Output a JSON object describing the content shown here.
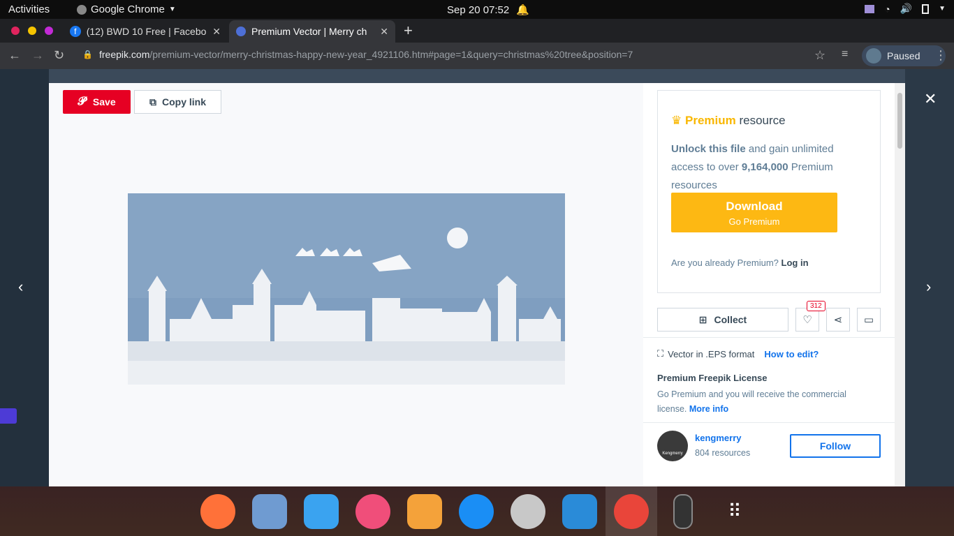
{
  "topbar": {
    "activities": "Activities",
    "app": "Google Chrome",
    "clock": "Sep 20  07:52"
  },
  "tabs": [
    {
      "title": "(12) BWD 10 Free | Facebo"
    },
    {
      "title": "Premium Vector | Merry ch"
    }
  ],
  "address": {
    "domain": "freepik.com",
    "path": "/premium-vector/merry-christmas-happy-new-year_4921106.htm#page=1&query=christmas%20tree&position=7",
    "profile_label": "Paused"
  },
  "preview": {
    "save_label": "Save",
    "copy_label": "Copy link"
  },
  "premium": {
    "title_gold": "Premium",
    "title_rest": " resource",
    "unlock_bold": "Unlock this file",
    "unlock_rest": " and gain unlimited access to over ",
    "count_bold": "9,164,000",
    "count_rest": " Premium resources",
    "download_label": "Download",
    "download_sub": "Go Premium",
    "already_text": "Are you already Premium?",
    "login_label": "Log in"
  },
  "actions": {
    "collect_label": "Collect",
    "likes_count": "312"
  },
  "details": {
    "format_text": "Vector in .EPS format",
    "how_to_edit": "How to edit?",
    "license_title": "Premium Freepik License",
    "license_text": "Go Premium and you will receive the commercial license.",
    "more_info": "More info"
  },
  "author": {
    "name": "kengmerry",
    "resources": "804 resources",
    "follow_label": "Follow",
    "avatar_text": "Kengmerry"
  },
  "colors": {
    "pinterest_red": "#e60023",
    "premium_gold": "#fdb813",
    "link_blue": "#1273eb"
  }
}
